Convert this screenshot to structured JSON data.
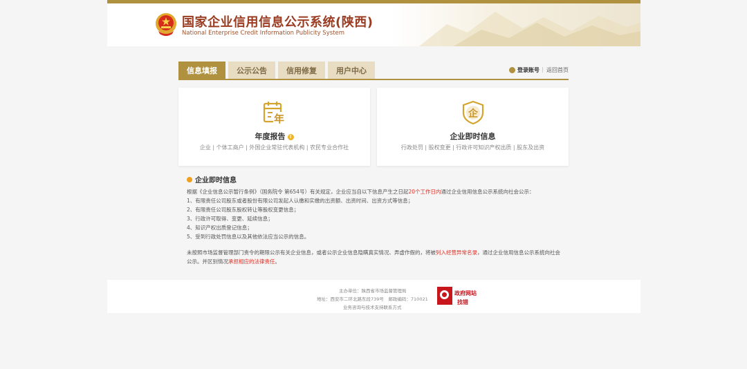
{
  "header": {
    "title_cn": "国家企业信用信息公示系统(陕西)",
    "title_en": "National Enterprise Credit Information Publicity System"
  },
  "nav": {
    "tabs": [
      {
        "label": "信息填报"
      },
      {
        "label": "公示公告"
      },
      {
        "label": "信用修复"
      },
      {
        "label": "用户中心"
      }
    ],
    "login_label": "登录账号",
    "separator": "|",
    "home_label": "返回首页"
  },
  "cards": [
    {
      "title": "年度报告",
      "icon": "calendar-year-icon",
      "subtitle": "企业 | 个体工商户 | 外国企业常驻代表机构 | 农民专业合作社"
    },
    {
      "title": "企业即时信息",
      "icon": "enterprise-shield-icon",
      "subtitle": "行政处罚 | 股权变更 | 行政许可知识产权出质 | 股东及出资"
    }
  ],
  "info": {
    "title": "企业即时信息",
    "intro_a": "根据《企业信息公示暂行条例》（国务院令 第654号）有关规定，企业应当自以下信息产生之日起",
    "intro_red": "20个工作日内",
    "intro_b": "通过企业信用信息公示系统向社会公示：",
    "items": [
      "1、有限责任公司股东或者股份有限公司发起人认缴和实缴的出资额、出资时间、出资方式等信息；",
      "2、有限责任公司股东股权转让等股权变更信息；",
      "3、行政许可取得、变更、延续信息；",
      "4、知识产权出质登记信息；",
      "5、受到行政处罚信息以及其他依法应当公示的信息。"
    ],
    "warn_a": "未按照市场监督管理部门责令的期限公示有关企业信息，或者公示企业信息隐瞒真实情况、弄虚作假的，将被",
    "warn_red1": "列入经营异常名录",
    "warn_b": "，通过企业信用信息公示系统向社会公示。并区别情况",
    "warn_red2": "承担相应的法律责任",
    "warn_c": "。"
  },
  "footer": {
    "host": "主办单位：陕西省市场监督管理局",
    "address": "地址：西安市二环北路东段739号　邮政编码：710021",
    "support": "业务咨询与技术支持联系方式",
    "gov_badge_line1": "政府网站",
    "gov_badge_line2": "找错"
  },
  "colors": {
    "gold": "#b0913f",
    "tab_inactive": "#e8dcc3",
    "title_red": "#9a3b22",
    "alert_red": "#e02b20"
  }
}
